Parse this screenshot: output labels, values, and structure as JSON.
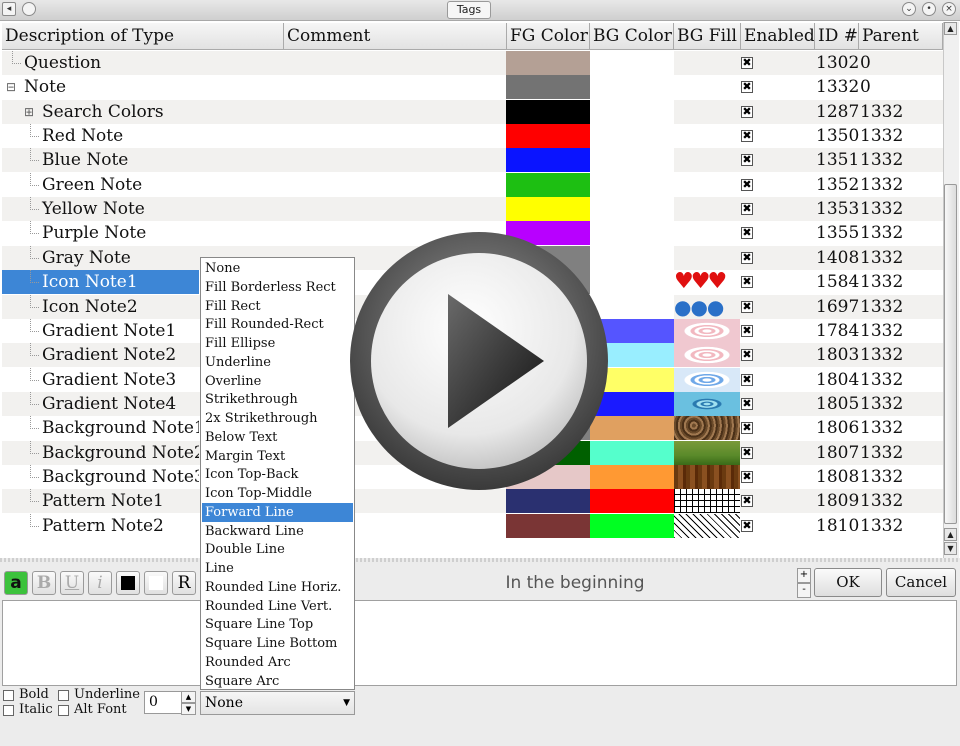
{
  "window": {
    "title": "Tags"
  },
  "columns": [
    "Description of Type",
    "Comment",
    "FG Color",
    "BG Color",
    "BG Fill",
    "Enabled",
    "ID #",
    "Parent"
  ],
  "rows": [
    {
      "label": "Question",
      "indent": 0,
      "expander": "",
      "fg": "#b4a095",
      "bg": "#ffffff",
      "fill": "",
      "enabled": true,
      "id": "1302",
      "parent": "0"
    },
    {
      "label": "Note",
      "indent": 0,
      "expander": "⊟",
      "fg": "#737373",
      "bg": "#ffffff",
      "fill": "",
      "enabled": true,
      "id": "1332",
      "parent": "0"
    },
    {
      "label": "Search Colors",
      "indent": 1,
      "expander": "⊞",
      "fg": "#000000",
      "bg": "#ffffff",
      "fill": "",
      "enabled": true,
      "id": "1287",
      "parent": "1332"
    },
    {
      "label": "Red Note",
      "indent": 1,
      "expander": "",
      "fg": "#ff0000",
      "bg": "#ffffff",
      "fill": "",
      "enabled": true,
      "id": "1350",
      "parent": "1332"
    },
    {
      "label": "Blue Note",
      "indent": 1,
      "expander": "",
      "fg": "#0a14ff",
      "bg": "#ffffff",
      "fill": "",
      "enabled": true,
      "id": "1351",
      "parent": "1332"
    },
    {
      "label": "Green Note",
      "indent": 1,
      "expander": "",
      "fg": "#1dbf12",
      "bg": "#ffffff",
      "fill": "",
      "enabled": true,
      "id": "1352",
      "parent": "1332"
    },
    {
      "label": "Yellow Note",
      "indent": 1,
      "expander": "",
      "fg": "#ffff00",
      "bg": "#ffffff",
      "fill": "",
      "enabled": true,
      "id": "1353",
      "parent": "1332"
    },
    {
      "label": "Purple Note",
      "indent": 1,
      "expander": "",
      "fg": "#b800ff",
      "bg": "#ffffff",
      "fill": "",
      "enabled": true,
      "id": "1355",
      "parent": "1332"
    },
    {
      "label": "Gray Note",
      "indent": 1,
      "expander": "",
      "fg": "#808080",
      "bg": "#ffffff",
      "fill": "",
      "enabled": true,
      "id": "1408",
      "parent": "1332"
    },
    {
      "label": "Icon Note1",
      "indent": 1,
      "expander": "",
      "fg": "#808080",
      "bg": "#ffffff",
      "fill": "hearts",
      "enabled": true,
      "id": "1584",
      "parent": "1332",
      "selected": true
    },
    {
      "label": "Icon Note2",
      "indent": 1,
      "expander": "",
      "fg": "#808080",
      "bg": "#ffffff",
      "fill": "globes",
      "enabled": true,
      "id": "1697",
      "parent": "1332"
    },
    {
      "label": "Gradient Note1",
      "indent": 1,
      "expander": "",
      "fg": "#808080",
      "bg": "#5555ff",
      "fill": "ripple-pink",
      "enabled": true,
      "id": "1784",
      "parent": "1332"
    },
    {
      "label": "Gradient Note2",
      "indent": 1,
      "expander": "",
      "fg": "#808080",
      "bg": "#99eeff",
      "fill": "ripple-pink",
      "enabled": true,
      "id": "1803",
      "parent": "1332"
    },
    {
      "label": "Gradient Note3",
      "indent": 1,
      "expander": "",
      "fg": "#808080",
      "bg": "#ffff66",
      "fill": "ripple-blue",
      "enabled": true,
      "id": "1804",
      "parent": "1332"
    },
    {
      "label": "Gradient Note4",
      "indent": 1,
      "expander": "",
      "fg": "#808080",
      "bg": "#1a1aff",
      "fill": "ripple-teal",
      "enabled": true,
      "id": "1805",
      "parent": "1332"
    },
    {
      "label": "Background Note1",
      "indent": 1,
      "expander": "",
      "fg": "#808080",
      "bg": "#e0a060",
      "fill": "gravel",
      "enabled": true,
      "id": "1806",
      "parent": "1332"
    },
    {
      "label": "Background Note2",
      "indent": 1,
      "expander": "",
      "fg": "#006000",
      "bg": "#55ffcc",
      "fill": "grass",
      "enabled": true,
      "id": "1807",
      "parent": "1332"
    },
    {
      "label": "Background Note3",
      "indent": 1,
      "expander": "",
      "fg": "#e6c8c8",
      "bg": "#ff9933",
      "fill": "wood",
      "enabled": true,
      "id": "1808",
      "parent": "1332"
    },
    {
      "label": "Pattern Note1",
      "indent": 1,
      "expander": "",
      "fg": "#2a3070",
      "bg": "#ff0000",
      "fill": "grid",
      "enabled": true,
      "id": "1809",
      "parent": "1332"
    },
    {
      "label": "Pattern Note2",
      "indent": 1,
      "expander": "",
      "fg": "#7a3535",
      "bg": "#00ff22",
      "fill": "diagonal",
      "enabled": true,
      "id": "1810",
      "parent": "1332"
    }
  ],
  "dropdown": {
    "options": [
      "None",
      "Fill Borderless Rect",
      "Fill Rect",
      "Fill Rounded-Rect",
      "Fill Ellipse",
      "Underline",
      "Overline",
      "Strikethrough",
      "2x Strikethrough",
      "Below Text",
      "Margin Text",
      "Icon Top-Back",
      "Icon Top-Middle",
      "Forward Line",
      "Backward Line",
      "Double Line",
      "Line",
      "Rounded Line Horiz.",
      "Rounded Line Vert.",
      "Square Line Top",
      "Square Line Bottom",
      "Rounded Arc",
      "Square Arc"
    ],
    "selected_index": 13,
    "combo_value": "None"
  },
  "toolbar": {
    "a": "a",
    "bold": "B",
    "underline": "U",
    "italic": "i",
    "r": "R"
  },
  "comment_text": "In the beginning",
  "ok_label": "OK",
  "cancel_label": "Cancel",
  "options": {
    "bold": "Bold",
    "underline": "Underline",
    "italic": "Italic",
    "alt_font": "Alt Font",
    "number": "0"
  },
  "icons": {
    "window_menu": "window-menu-icon",
    "shade": "shade-icon",
    "minimize": "minimize-icon",
    "maximize": "maximize-icon",
    "close": "close-icon",
    "play": "play-overlay-icon"
  }
}
